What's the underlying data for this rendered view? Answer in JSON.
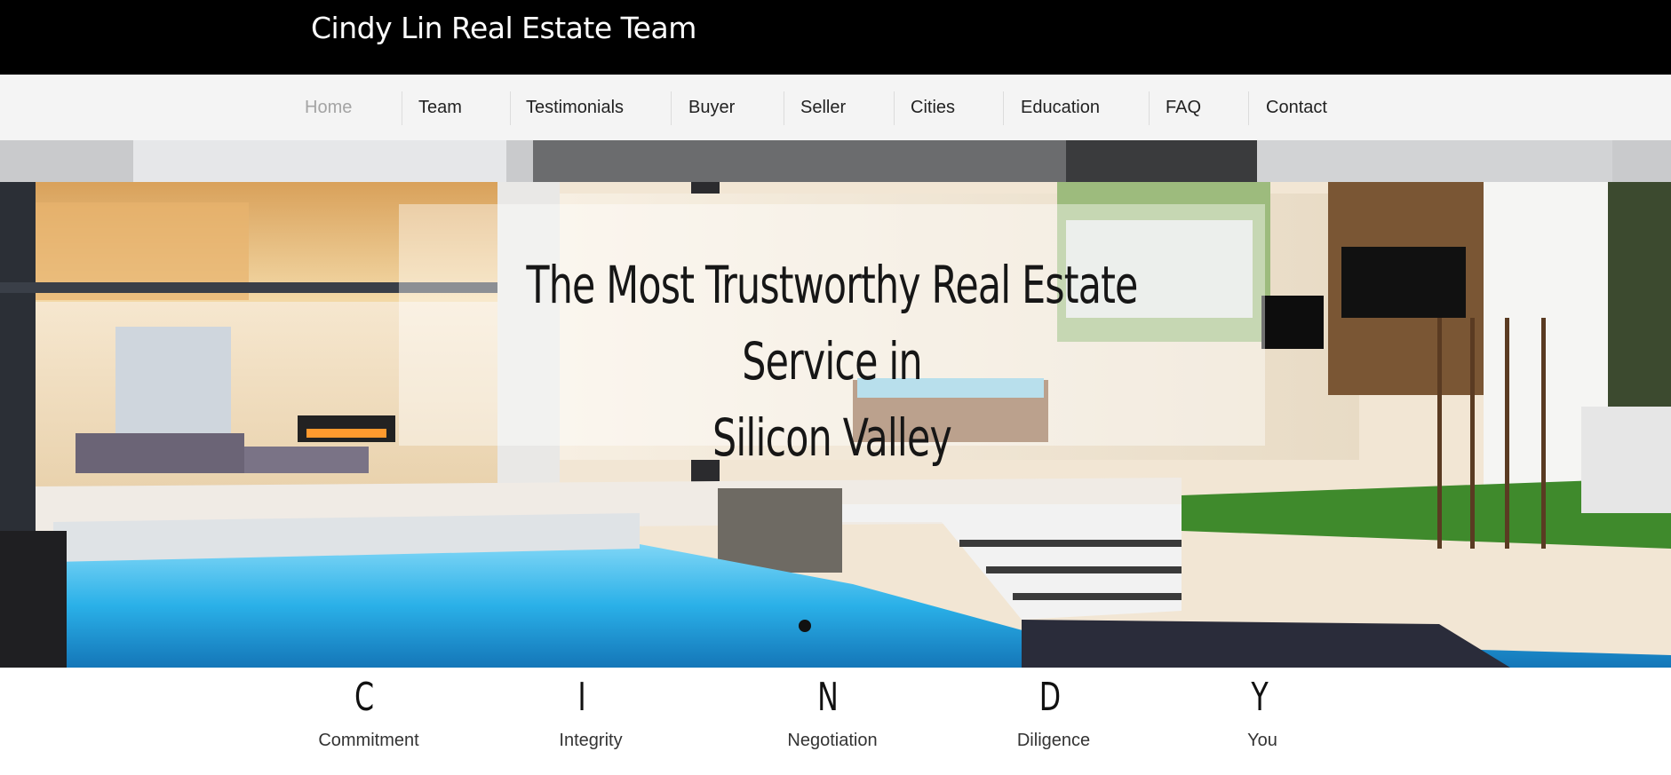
{
  "header": {
    "site_title": "Cindy Lin Real Estate Team"
  },
  "nav": {
    "items": [
      {
        "label": "Home",
        "active": true
      },
      {
        "label": "Team"
      },
      {
        "label": "Testimonials"
      },
      {
        "label": "Buyer"
      },
      {
        "label": "Seller"
      },
      {
        "label": "Cities"
      },
      {
        "label": "Education"
      },
      {
        "label": "FAQ"
      },
      {
        "label": "Contact"
      }
    ]
  },
  "hero": {
    "headline_line1": "The Most Trustworthy Real Estate Service in",
    "headline_line2": "Silicon Valley"
  },
  "acronym": [
    {
      "letter": "C",
      "word": "Commitment"
    },
    {
      "letter": "I",
      "word": "Integrity"
    },
    {
      "letter": "N",
      "word": "Negotiation"
    },
    {
      "letter": "D",
      "word": "Diligence"
    },
    {
      "letter": "Y",
      "word": "You"
    }
  ],
  "colors": {
    "topbar": "#000000",
    "navbar": "#f4f4f4",
    "nav_active": "#a4a4a4",
    "pool": "#2ab0e8"
  }
}
